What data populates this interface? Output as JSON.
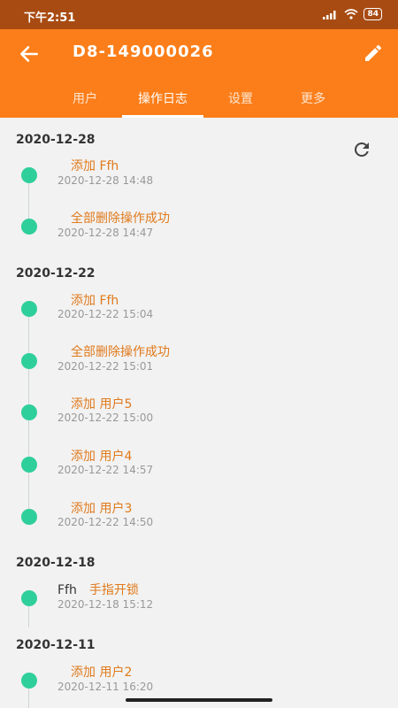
{
  "status_bar": {
    "time": "下午2:51",
    "battery": "84"
  },
  "header": {
    "title": "D8-149000026"
  },
  "tabs": [
    "用户",
    "操作日志",
    "设置",
    "更多"
  ],
  "groups": [
    {
      "date": "2020-12-28",
      "entries": [
        {
          "action": "添加 Ffh",
          "time": "2020-12-28 14:48"
        },
        {
          "action": "全部删除操作成功",
          "time": "2020-12-28 14:47"
        }
      ]
    },
    {
      "date": "2020-12-22",
      "entries": [
        {
          "action": "添加 Ffh",
          "time": "2020-12-22 15:04"
        },
        {
          "action": "全部删除操作成功",
          "time": "2020-12-22 15:01"
        },
        {
          "action": "添加 用户5",
          "time": "2020-12-22 15:00"
        },
        {
          "action": "添加 用户4",
          "time": "2020-12-22 14:57"
        },
        {
          "action": "添加 用户3",
          "time": "2020-12-22 14:50"
        }
      ]
    },
    {
      "date": "2020-12-18",
      "entries": [
        {
          "user": "Ffh",
          "action": "手指开锁",
          "time": "2020-12-18 15:12"
        }
      ]
    },
    {
      "date": "2020-12-11",
      "entries": [
        {
          "action": "添加 用户2",
          "time": "2020-12-11 16:20"
        }
      ]
    }
  ]
}
